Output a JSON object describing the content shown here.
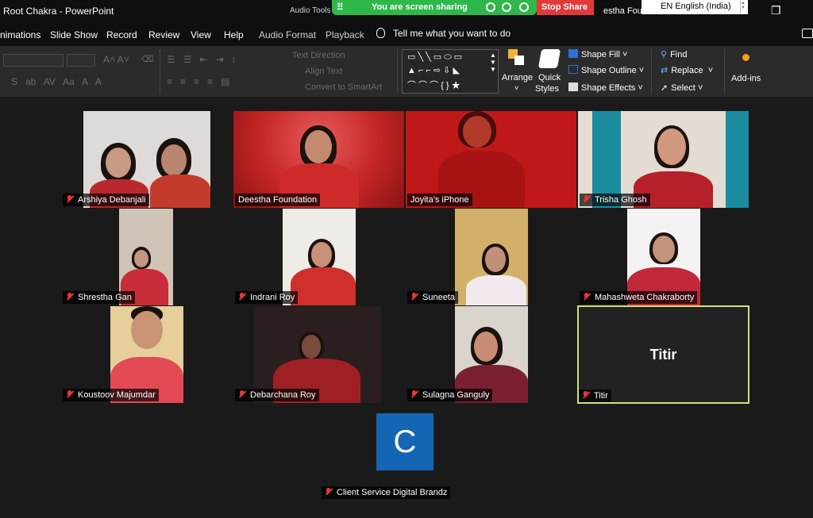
{
  "window": {
    "title": "Root Chakra  -  PowerPoint",
    "audio_tools": "Audio Tools",
    "tab_fragment": "estha Found"
  },
  "share_bar": {
    "label": "You are screen sharing",
    "stop_label": "Stop Share",
    "bg_color": "#2fb84a",
    "stop_color": "#e23a3a"
  },
  "language": {
    "label": "EN English (India)"
  },
  "ribbon_tabs": [
    {
      "label": "nimations"
    },
    {
      "label": "Slide Show"
    },
    {
      "label": "Record"
    },
    {
      "label": "Review"
    },
    {
      "label": "View"
    },
    {
      "label": "Help"
    },
    {
      "label": "Audio Format"
    },
    {
      "label": "Playback"
    }
  ],
  "tell_me": "Tell me what you want to do",
  "ribbon": {
    "text_direction": "Text Direction",
    "align_text": "Align Text",
    "convert_smartart": "Convert to SmartArt",
    "arrange": "Arrange",
    "quick": "Quick",
    "styles": "Styles",
    "shape_fill": "Shape Fill",
    "shape_outline": "Shape Outline",
    "shape_effects": "Shape Effects",
    "find": "Find",
    "replace": "Replace",
    "select": "Select",
    "addins": "Add-ins"
  },
  "participants": [
    {
      "name": "Arshiya Debanjali",
      "muted": true
    },
    {
      "name": "Deestha Foundation",
      "muted": false
    },
    {
      "name": "Joyita's iPhone",
      "muted": false
    },
    {
      "name": "Trisha Ghosh",
      "muted": true
    },
    {
      "name": "Shrestha Gan",
      "muted": true
    },
    {
      "name": "Indrani Roy",
      "muted": true
    },
    {
      "name": "Suneeta",
      "muted": true
    },
    {
      "name": "Mahashweta Chakraborty",
      "muted": true
    },
    {
      "name": "Koustoov Majumdar",
      "muted": true
    },
    {
      "name": "Debarchana Roy",
      "muted": true
    },
    {
      "name": "Sulagna Ganguly",
      "muted": true
    },
    {
      "name": "Titir",
      "muted": true,
      "video_off": true,
      "highlight_color": "#d2e275"
    },
    {
      "name": "Client Service Digital Brandz",
      "muted": true,
      "video_off": true,
      "avatar_letter": "C",
      "avatar_color": "#1565b5"
    }
  ]
}
